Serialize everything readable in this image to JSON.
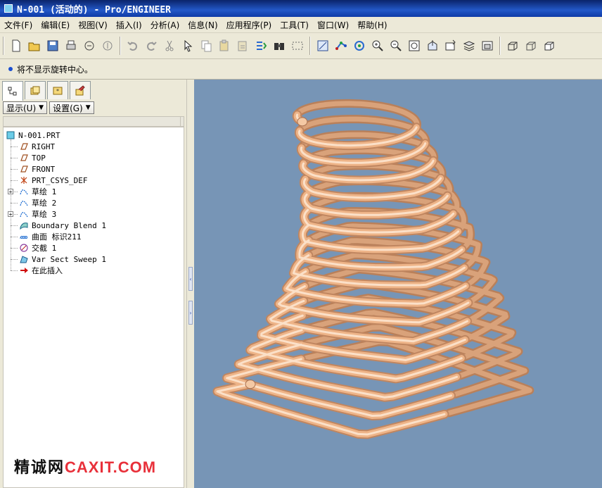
{
  "window": {
    "title": "N-001 (活动的) - Pro/ENGINEER"
  },
  "menu": [
    {
      "label": "文件(F)",
      "name": "menu-file"
    },
    {
      "label": "编辑(E)",
      "name": "menu-edit"
    },
    {
      "label": "视图(V)",
      "name": "menu-view"
    },
    {
      "label": "插入(I)",
      "name": "menu-insert"
    },
    {
      "label": "分析(A)",
      "name": "menu-analysis"
    },
    {
      "label": "信息(N)",
      "name": "menu-info"
    },
    {
      "label": "应用程序(P)",
      "name": "menu-applications"
    },
    {
      "label": "工具(T)",
      "name": "menu-tools"
    },
    {
      "label": "窗口(W)",
      "name": "menu-window"
    },
    {
      "label": "帮助(H)",
      "name": "menu-help"
    }
  ],
  "toolbar": {
    "icons": [
      "new-file-icon",
      "open-file-icon",
      "save-icon",
      "print-icon",
      "send-mail-icon",
      "mail-recipient-icon",
      "separator",
      "undo-icon",
      "redo-icon",
      "cut-icon",
      "select-arrow-icon",
      "copy-icon",
      "paste-icon",
      "paste-special-icon",
      "regenerate-icon",
      "find-binoculars-icon",
      "selection-box-icon",
      "separator",
      "repaint-icon",
      "spin-center-icon",
      "orient-mode-icon",
      "zoom-in-icon",
      "zoom-out-icon",
      "refit-icon",
      "reorient-icon",
      "saved-views-icon",
      "layers-icon",
      "view-manager-icon",
      "separator",
      "wireframe-icon",
      "hidden-line-icon",
      "no-hidden-icon"
    ]
  },
  "message": {
    "text": "将不显示旋转中心。"
  },
  "panel": {
    "tabs": [
      "model-tree-tab-icon",
      "folder-browser-tab-icon",
      "favorites-tab-icon",
      "connections-tab-icon"
    ],
    "show_button": "显示(U)",
    "settings_button": "设置(G)"
  },
  "tree": {
    "root": "N-001.PRT",
    "items": [
      {
        "label": "RIGHT",
        "icon": "datum-plane-icon",
        "expandable": false
      },
      {
        "label": "TOP",
        "icon": "datum-plane-icon",
        "expandable": false
      },
      {
        "label": "FRONT",
        "icon": "datum-plane-icon",
        "expandable": false
      },
      {
        "label": "PRT_CSYS_DEF",
        "icon": "coordinate-system-icon",
        "expandable": false
      },
      {
        "label": "草绘 1",
        "icon": "sketch-icon",
        "expandable": true
      },
      {
        "label": "草绘 2",
        "icon": "sketch-icon",
        "expandable": false
      },
      {
        "label": "草绘 3",
        "icon": "sketch-icon",
        "expandable": true
      },
      {
        "label": "Boundary Blend 1",
        "icon": "boundary-blend-icon",
        "expandable": false
      },
      {
        "label": "曲面 标识211",
        "icon": "surface-icon",
        "expandable": false
      },
      {
        "label": "交截 1",
        "icon": "intersect-icon",
        "expandable": false
      },
      {
        "label": "Var Sect Sweep 1",
        "icon": "variable-section-sweep-icon",
        "expandable": false
      },
      {
        "label": "在此插入",
        "icon": "insert-here-arrow-icon",
        "expandable": false
      }
    ]
  },
  "model": {
    "description_icon": "helical-spring-model",
    "spring_color": "#eeb488",
    "background_color": "#7795b6"
  },
  "watermark": {
    "cn": "精诚网",
    "en": "CAXIT.COM"
  }
}
